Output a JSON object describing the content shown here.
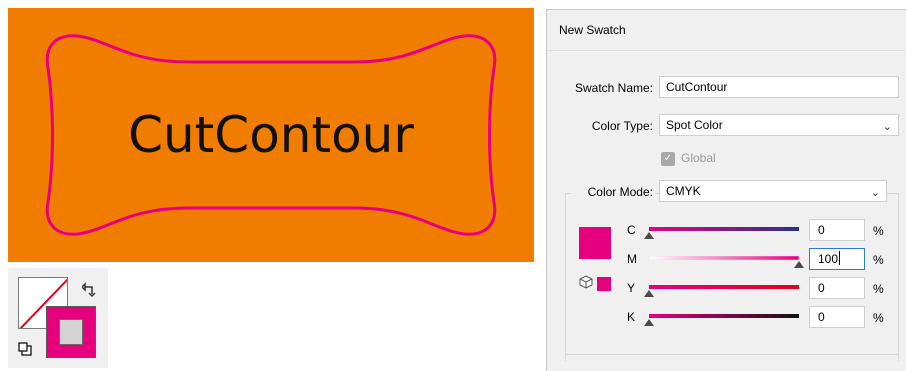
{
  "artboard": {
    "text": "CutContour",
    "background_color": "#f07c00",
    "contour_color": "#e6007e"
  },
  "tools": {
    "fill_icon": "fill-none-icon",
    "stroke_icon": "stroke-swatch-icon",
    "swap_icon": "swap-arrow-icon",
    "default_icon": "default-colors-icon"
  },
  "dialog": {
    "title": "New Swatch",
    "swatch_name_label": "Swatch Name:",
    "swatch_name_value": "CutContour",
    "color_type_label": "Color Type:",
    "color_type_value": "Spot Color",
    "global_label": "Global",
    "global_checked": true,
    "color_mode_label": "Color Mode:",
    "color_mode_value": "CMYK",
    "swatch_color": "#e6007e",
    "channels": [
      {
        "label": "C",
        "value": "0",
        "unit": "%"
      },
      {
        "label": "M",
        "value": "100",
        "unit": "%"
      },
      {
        "label": "Y",
        "value": "0",
        "unit": "%"
      },
      {
        "label": "K",
        "value": "0",
        "unit": "%"
      }
    ]
  }
}
